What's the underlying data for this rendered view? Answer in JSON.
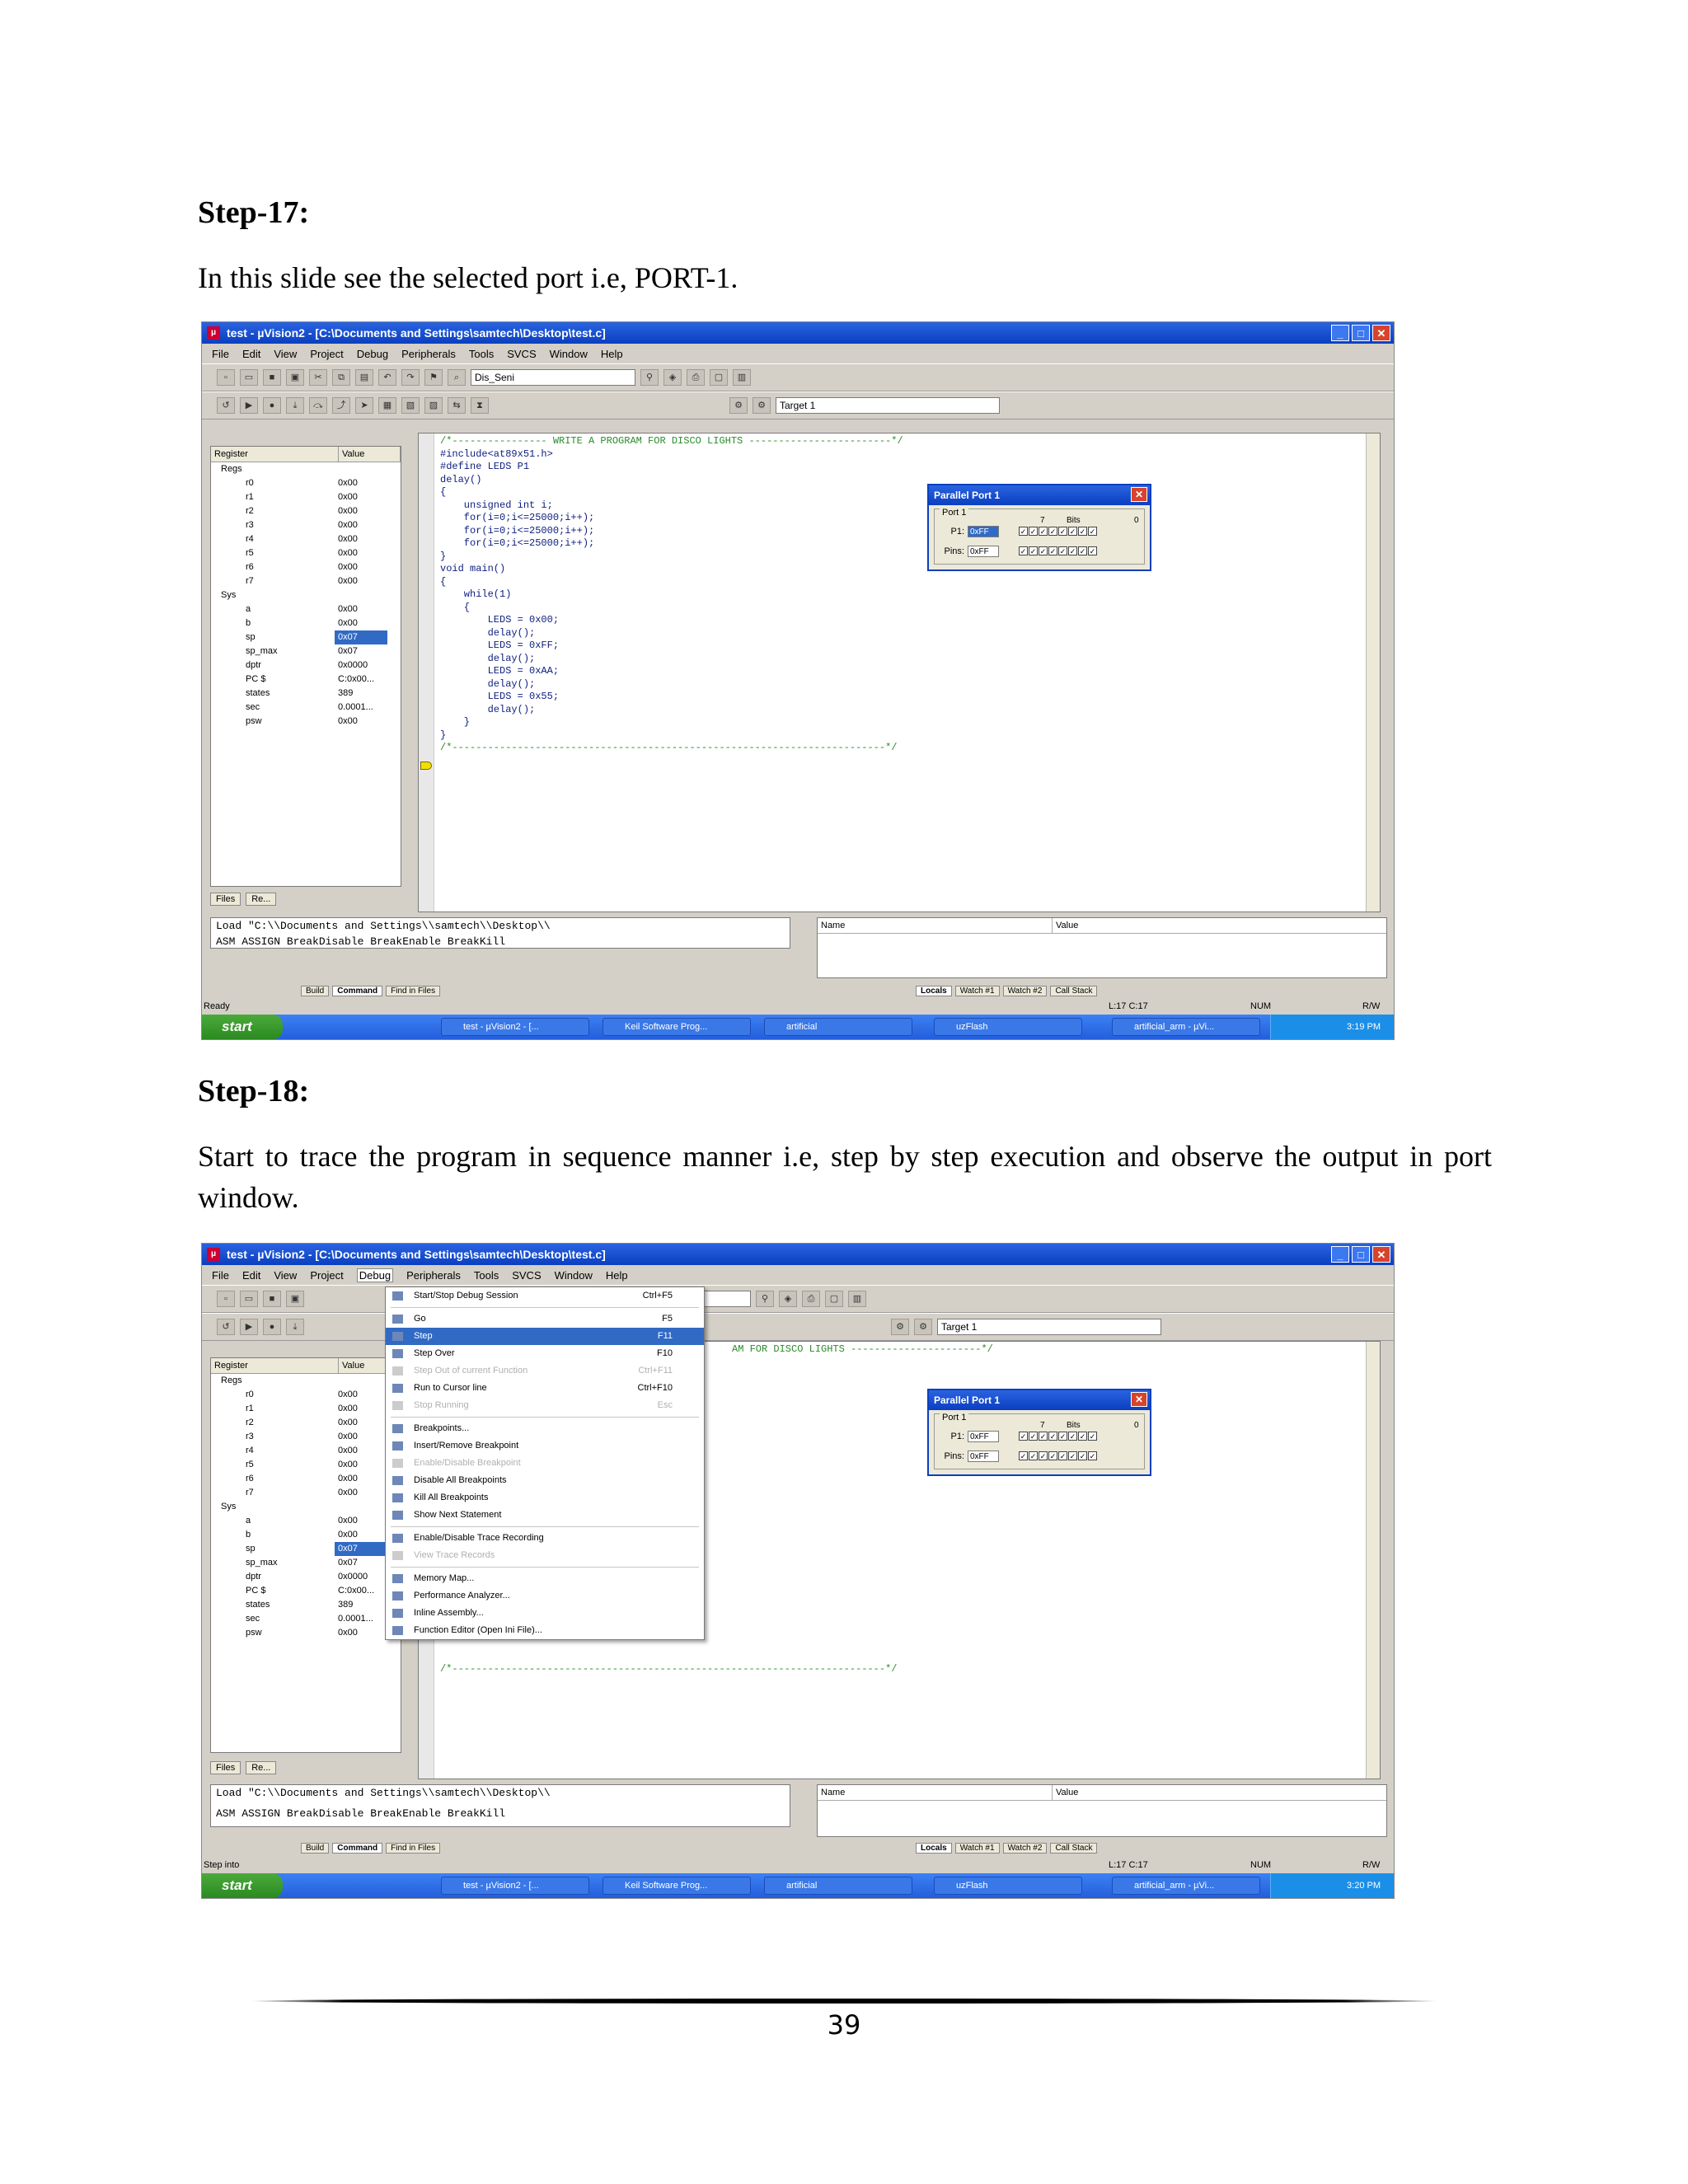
{
  "step17": {
    "heading": "Step-17:",
    "text": "In this slide see the selected port i.e, PORT-1."
  },
  "step18": {
    "heading": "Step-18:",
    "text": "Start to trace the program in sequence manner i.e, step by step execution and observe the output in port window."
  },
  "window": {
    "title": "test - µVision2 - [C:\\Documents and Settings\\samtech\\Desktop\\test.c]",
    "minimize": "_",
    "maximize": "□",
    "close": "✕"
  },
  "menubar": [
    "File",
    "Edit",
    "View",
    "Project",
    "Debug",
    "Peripherals",
    "Tools",
    "SVCS",
    "Window",
    "Help"
  ],
  "toolbar": {
    "combo_text": "Dis_Seni",
    "combo_text2": "Seni",
    "target": "Target 1"
  },
  "registers": {
    "header_name": "Register",
    "header_value": "Value",
    "rows": [
      {
        "name": "Regs",
        "value": ""
      },
      {
        "name": "r0",
        "value": "0x00"
      },
      {
        "name": "r1",
        "value": "0x00"
      },
      {
        "name": "r2",
        "value": "0x00"
      },
      {
        "name": "r3",
        "value": "0x00"
      },
      {
        "name": "r4",
        "value": "0x00"
      },
      {
        "name": "r5",
        "value": "0x00"
      },
      {
        "name": "r6",
        "value": "0x00"
      },
      {
        "name": "r7",
        "value": "0x00"
      },
      {
        "name": "Sys",
        "value": ""
      },
      {
        "name": "a",
        "value": "0x00"
      },
      {
        "name": "b",
        "value": "0x00"
      },
      {
        "name": "sp",
        "value": "0x07"
      },
      {
        "name": "sp_max",
        "value": "0x07"
      },
      {
        "name": "dptr",
        "value": "0x0000"
      },
      {
        "name": "PC $",
        "value": "C:0x00..."
      },
      {
        "name": "states",
        "value": "389"
      },
      {
        "name": "sec",
        "value": "0.0001..."
      },
      {
        "name": "psw",
        "value": "0x00"
      }
    ],
    "selected_index": 12
  },
  "pane_tabs": {
    "files": "Files",
    "regs": "Re..."
  },
  "code": {
    "comment_top": "/*---------------- WRITE A PROGRAM FOR DISCO LIGHTS ------------------------*/",
    "lines": [
      "#include<at89x51.h>",
      "#define LEDS P1",
      "delay()",
      "{",
      "    unsigned int i;",
      "    for(i=0;i<=25000;i++);",
      "    for(i=0;i<=25000;i++);",
      "    for(i=0;i<=25000;i++);",
      "}",
      "void main()",
      "{",
      "    while(1)",
      "    {",
      "        LEDS = 0x00;",
      "        delay();",
      "        LEDS = 0xFF;",
      "        delay();",
      "        LEDS = 0xAA;",
      "        delay();",
      "        LEDS = 0x55;",
      "        delay();",
      "    }",
      "}"
    ],
    "comment_bottom": "/*-------------------------------------------------------------------------*/",
    "partial_comment": "AM FOR DISCO LIGHTS ----------------------*/"
  },
  "parallel_port": {
    "title": "Parallel Port 1",
    "group": "Port 1",
    "p1_label": "P1:",
    "p1_value": "0xFF",
    "pins_label": "Pins:",
    "pins_value": "0xFF",
    "bits_label": "Bits",
    "bit_hi": "7",
    "bit_lo": "0",
    "check": "✓"
  },
  "command": {
    "line1": "Load \"C:\\\\Documents and Settings\\\\samtech\\\\Desktop\\\\",
    "line2": "ASM ASSIGN BreakDisable BreakEnable BreakKill",
    "tabs": [
      "Build",
      "Command",
      "Find in Files"
    ]
  },
  "watch": {
    "name_header": "Name",
    "value_header": "Value",
    "tabs": [
      "Locals",
      "Watch #1",
      "Watch #2",
      "Call Stack"
    ]
  },
  "status": {
    "ready": "Ready",
    "step_into": "Step into",
    "position": "L:17 C:17",
    "num": "NUM",
    "rw": "R/W"
  },
  "taskbar": {
    "start": "start",
    "tasks": [
      "test - µVision2 - [...",
      "Keil Software Prog...",
      "artificial",
      "uzFlash",
      "artificial_arm - µVi..."
    ],
    "time1": "3:19 PM",
    "time2": "3:20 PM"
  },
  "debug_menu": {
    "items": [
      {
        "label": "Start/Stop Debug Session",
        "shortcut": "Ctrl+F5",
        "state": "normal"
      },
      {
        "sep": true
      },
      {
        "label": "Go",
        "shortcut": "F5",
        "state": "normal"
      },
      {
        "label": "Step",
        "shortcut": "F11",
        "state": "highlight"
      },
      {
        "label": "Step Over",
        "shortcut": "F10",
        "state": "normal"
      },
      {
        "label": "Step Out of current Function",
        "shortcut": "Ctrl+F11",
        "state": "disabled"
      },
      {
        "label": "Run to Cursor line",
        "shortcut": "Ctrl+F10",
        "state": "normal"
      },
      {
        "label": "Stop Running",
        "shortcut": "Esc",
        "state": "disabled"
      },
      {
        "sep": true
      },
      {
        "label": "Breakpoints...",
        "shortcut": "",
        "state": "normal"
      },
      {
        "label": "Insert/Remove Breakpoint",
        "shortcut": "",
        "state": "normal"
      },
      {
        "label": "Enable/Disable Breakpoint",
        "shortcut": "",
        "state": "disabled"
      },
      {
        "label": "Disable All Breakpoints",
        "shortcut": "",
        "state": "normal"
      },
      {
        "label": "Kill All Breakpoints",
        "shortcut": "",
        "state": "normal"
      },
      {
        "label": "Show Next Statement",
        "shortcut": "",
        "state": "normal"
      },
      {
        "sep": true
      },
      {
        "label": "Enable/Disable Trace Recording",
        "shortcut": "",
        "state": "normal"
      },
      {
        "label": "View Trace Records",
        "shortcut": "",
        "state": "disabled"
      },
      {
        "sep": true
      },
      {
        "label": "Memory Map...",
        "shortcut": "",
        "state": "normal"
      },
      {
        "label": "Performance Analyzer...",
        "shortcut": "",
        "state": "normal"
      },
      {
        "label": "Inline Assembly...",
        "shortcut": "",
        "state": "normal"
      },
      {
        "label": "Function Editor (Open Ini File)...",
        "shortcut": "",
        "state": "normal"
      }
    ]
  },
  "page_number": "39"
}
